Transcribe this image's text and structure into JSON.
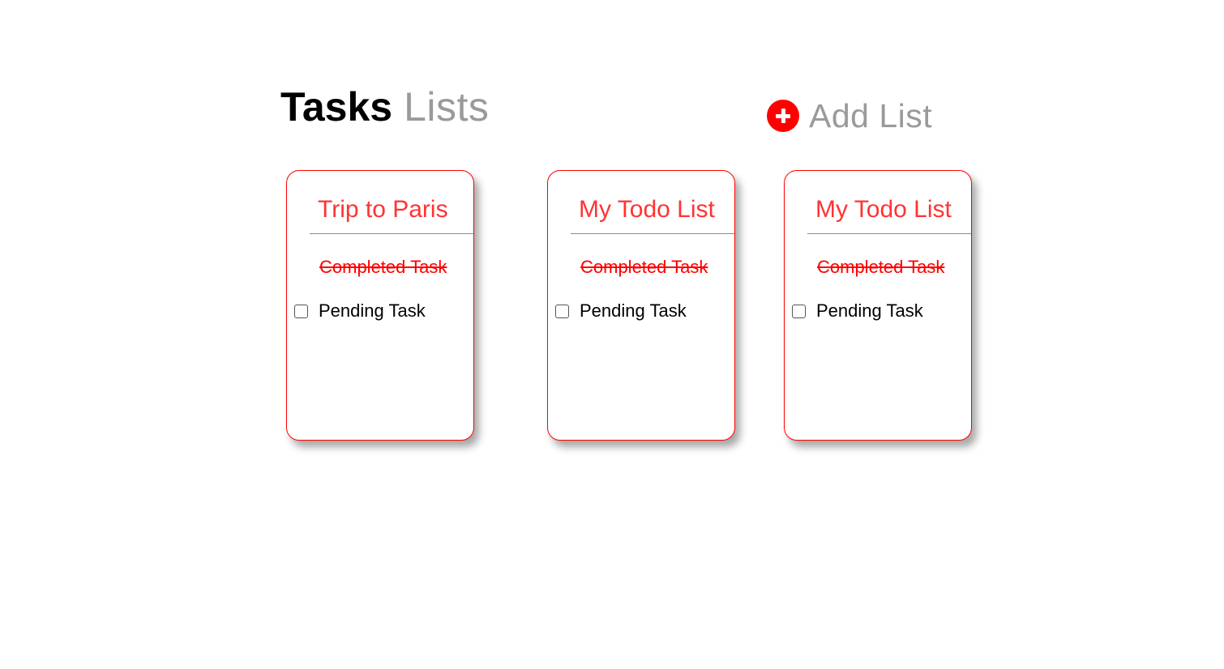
{
  "header": {
    "title_strong": "Tasks",
    "title_light": "Lists"
  },
  "add_list": {
    "icon": "plus-circle-icon",
    "label": "Add List"
  },
  "colors": {
    "accent": "#ff0000",
    "muted_text": "#9a9a9a"
  },
  "lists": [
    {
      "title": "Trip to Paris",
      "completed_task": "Completed Task",
      "pending_task": "Pending Task",
      "pending_checked": false
    },
    {
      "title": "My Todo List",
      "completed_task": "Completed Task",
      "pending_task": "Pending Task",
      "pending_checked": false
    },
    {
      "title": "My Todo List",
      "completed_task": "Completed Task",
      "pending_task": "Pending Task",
      "pending_checked": false
    }
  ]
}
